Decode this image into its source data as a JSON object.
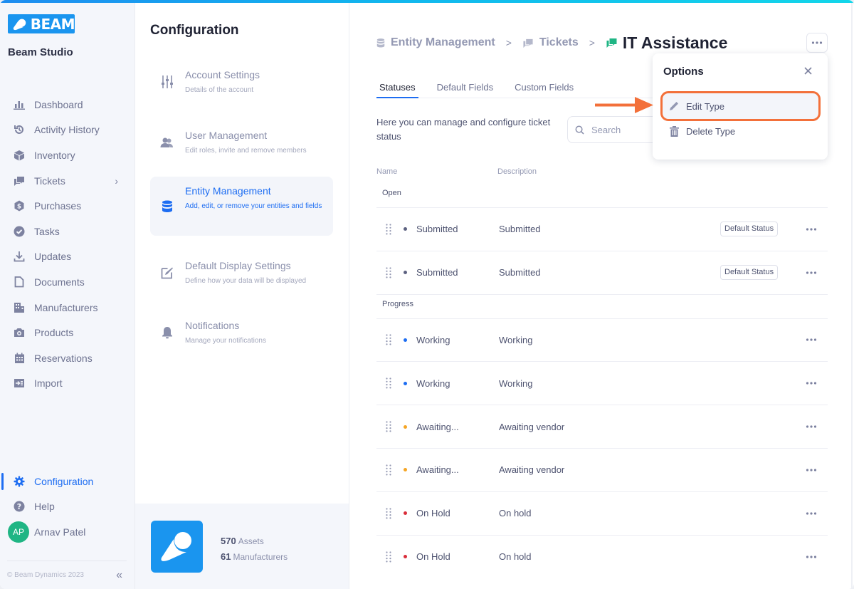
{
  "app": {
    "brand": "BEAM",
    "name": "Beam Studio",
    "accent_color": "#1d6df2",
    "brand_color": "#1a95ef"
  },
  "sidebar": {
    "items": [
      {
        "label": "Dashboard",
        "icon": "bar-chart-icon"
      },
      {
        "label": "Activity History",
        "icon": "history-icon"
      },
      {
        "label": "Inventory",
        "icon": "box-icon"
      },
      {
        "label": "Tickets",
        "icon": "chat-icon",
        "has_submenu": true
      },
      {
        "label": "Purchases",
        "icon": "dollar-badge-icon"
      },
      {
        "label": "Tasks",
        "icon": "check-circle-icon"
      },
      {
        "label": "Updates",
        "icon": "download-icon"
      },
      {
        "label": "Documents",
        "icon": "document-icon"
      },
      {
        "label": "Manufacturers",
        "icon": "building-icon"
      },
      {
        "label": "Products",
        "icon": "camera-icon"
      },
      {
        "label": "Reservations",
        "icon": "calendar-icon"
      },
      {
        "label": "Import",
        "icon": "import-icon"
      }
    ],
    "bottom_items": [
      {
        "label": "Configuration",
        "icon": "gear-icon",
        "active": true
      },
      {
        "label": "Help",
        "icon": "help-icon"
      }
    ],
    "user": {
      "initials": "AP",
      "name": "Arnav Patel",
      "avatar_color": "#1fb584"
    },
    "copyright": "© Beam Dynamics 2023",
    "collapse_icon": "double-chevron-left-icon"
  },
  "config": {
    "title": "Configuration",
    "items": [
      {
        "title": "Account Settings",
        "desc": "Details of the account",
        "icon": "sliders-icon"
      },
      {
        "title": "User Management",
        "desc": "Edit roles, invite and remove members",
        "icon": "users-icon"
      },
      {
        "title": "Entity Management",
        "desc": "Add, edit, or remove your entities and fields",
        "icon": "database-icon",
        "active": true
      },
      {
        "title": "Default Display Settings",
        "desc": "Define how your data will be displayed",
        "icon": "edit-square-icon"
      },
      {
        "title": "Notifications",
        "desc": "Manage your notifications",
        "icon": "bell-icon"
      }
    ],
    "stats": [
      {
        "value": "570",
        "label": "Assets"
      },
      {
        "value": "61",
        "label": "Manufacturers"
      }
    ]
  },
  "main": {
    "breadcrumb": [
      {
        "label": "Entity Management",
        "icon": "database-icon"
      },
      {
        "label": "Tickets",
        "icon": "chat-icon"
      }
    ],
    "current": {
      "label": "IT Assistance",
      "icon": "chat-icon",
      "icon_color": "#1fb584"
    },
    "tabs": [
      {
        "label": "Statuses",
        "active": true
      },
      {
        "label": "Default Fields"
      },
      {
        "label": "Custom Fields"
      }
    ],
    "description": "Here you can manage and configure ticket status",
    "search": {
      "placeholder": "Search",
      "value": ""
    },
    "columns": {
      "name": "Name",
      "description": "Description"
    },
    "groups": [
      {
        "label": "Open",
        "rows": [
          {
            "name": "Submitted",
            "description": "Submitted",
            "color": "#5c6180",
            "badge": "Default Status"
          },
          {
            "name": "Submitted",
            "description": "Submitted",
            "color": "#5c6180",
            "badge": "Default Status"
          }
        ]
      },
      {
        "label": "Progress",
        "rows": [
          {
            "name": "Working",
            "description": "Working",
            "color": "#1d6df2"
          },
          {
            "name": "Working",
            "description": "Working",
            "color": "#1d6df2"
          },
          {
            "name": "Awaiting...",
            "description": "Awaiting vendor",
            "color": "#f5a524"
          },
          {
            "name": "Awaiting...",
            "description": "Awaiting vendor",
            "color": "#f5a524"
          },
          {
            "name": "On Hold",
            "description": "On hold",
            "color": "#d92d3a"
          },
          {
            "name": "On Hold",
            "description": "On hold",
            "color": "#d92d3a"
          }
        ]
      }
    ]
  },
  "options_popover": {
    "title": "Options",
    "items": [
      {
        "label": "Edit Type",
        "icon": "pencil-icon",
        "highlighted": true
      },
      {
        "label": "Delete Type",
        "icon": "trash-icon"
      }
    ],
    "highlight_color": "#f3703a"
  }
}
